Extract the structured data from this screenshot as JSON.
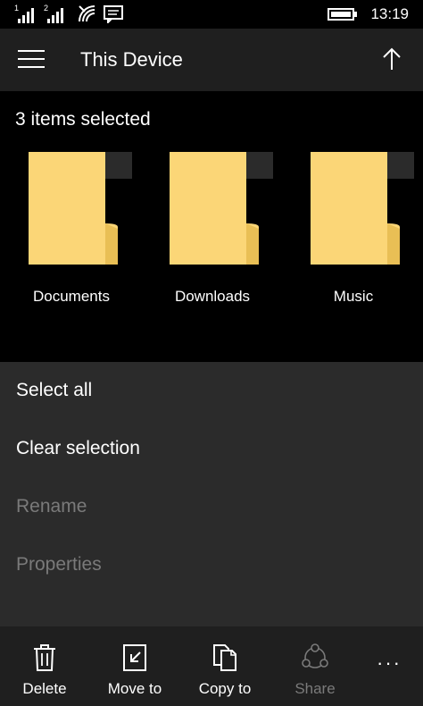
{
  "status_bar": {
    "sim1_label": "1",
    "sim2_label": "2",
    "time": "13:19"
  },
  "header": {
    "title": "This Device"
  },
  "selection": {
    "count_text": "3 items selected",
    "folders": [
      {
        "name": "Documents"
      },
      {
        "name": "Downloads"
      },
      {
        "name": "Music"
      }
    ]
  },
  "menu": {
    "items": [
      {
        "label": "Select all",
        "enabled": true
      },
      {
        "label": "Clear selection",
        "enabled": true
      },
      {
        "label": "Rename",
        "enabled": false
      },
      {
        "label": "Properties",
        "enabled": false
      }
    ]
  },
  "app_bar": {
    "buttons": [
      {
        "label": "Delete",
        "icon": "trash-icon",
        "enabled": true
      },
      {
        "label": "Move to",
        "icon": "move-to-icon",
        "enabled": true
      },
      {
        "label": "Copy to",
        "icon": "copy-icon",
        "enabled": true
      },
      {
        "label": "Share",
        "icon": "share-icon",
        "enabled": false
      }
    ],
    "more_label": "···"
  },
  "colors": {
    "folder": "#fbd677",
    "folder_fold": "#e9bf55",
    "header_bg": "#1f1f1f",
    "menu_bg": "#2b2b2b",
    "disabled_text": "#7a7a7a"
  }
}
